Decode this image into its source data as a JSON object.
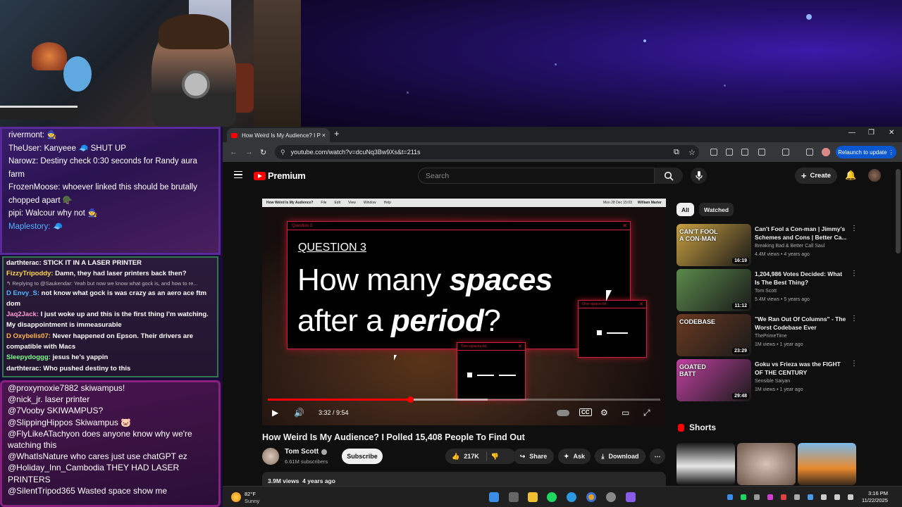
{
  "webcam": {
    "scene": "streamer-webcam"
  },
  "chat_top": [
    {
      "user": "rivermont:",
      "msg": " 🧙",
      "blue": false
    },
    {
      "user": "TheUser:",
      "msg": " Kanyeee 🧢 SHUT UP",
      "blue": false
    },
    {
      "user": "Narowz:",
      "msg": " Destiny check 0:30 seconds for Randy aura farm",
      "blue": false
    },
    {
      "user": "FrozenMoose:",
      "msg": " whoever linked this should be brutally chopped apart 🪖",
      "blue": false
    },
    {
      "user": "pipi:",
      "msg": " Walcour why not 🧙",
      "blue": false
    },
    {
      "user": "Maplestory:",
      "msg": " 🧢",
      "blue": true
    }
  ],
  "chat_mid": [
    {
      "user": "darthterac:",
      "msg": " STICK IT IN A LASER PRINTER",
      "color": "#ffffff"
    },
    {
      "user": "FizzyTripoddy:",
      "msg": " Damn, they had laser printers back then?",
      "color": "#ffd84a"
    },
    {
      "reply": "↰ Replying to @Saukendar: Yeah but now we know what gock is, and how to re..."
    },
    {
      "user": "D Envy_S:",
      "msg": " not know what gock is was crazy as an aero ace ftm dom",
      "color": "#4fb4ff"
    },
    {
      "user": "Jaq2Jack:",
      "msg": " I just woke up and this is the first thing I'm watching. My disappointment is immeasurable",
      "color": "#ff9ad0"
    },
    {
      "user": "D Oxybelis07:",
      "msg": " Never happened on Epson. Their drivers are compatible with Macs",
      "color": "#ffb84a"
    },
    {
      "user": "Sleepydoggg:",
      "msg": " jesus he's yappin",
      "color": "#7cff8a"
    },
    {
      "user": "darthterac:",
      "msg": " Who pushed destiny to this",
      "color": "#ffffff"
    }
  ],
  "chat_bot": [
    {
      "user": "@proxymoxie7882",
      "msg": " skiwampus!"
    },
    {
      "user": "@nick_jr.",
      "msg": " laser printer"
    },
    {
      "user": "@7Vooby",
      "msg": " SKIWAMPUS?"
    },
    {
      "user": "@SlippingHippos",
      "msg": " Skiwampus 🐷"
    },
    {
      "user": "@FlyLikeATachyon",
      "msg": " does anyone know why we're watching this"
    },
    {
      "user": "@WhatIsNature",
      "msg": " who cares just use chatGPT ez"
    },
    {
      "user": "@Holiday_Inn_Cambodia",
      "msg": " THEY HAD LASER PRINTERS"
    },
    {
      "user": "@SilentTripod365",
      "msg": " Wasted space show me"
    }
  ],
  "browser": {
    "tab_title": "How Weird Is My Audience? I P",
    "url": "youtube.com/watch?v=dcuNq3Bw9Xs&t=211s",
    "relaunch_label": "Relaunch to update"
  },
  "youtube": {
    "brand": "Premium",
    "search_placeholder": "Search",
    "create_label": "Create"
  },
  "player": {
    "mac_menu": [
      "How Weird Is My Audience?",
      "File",
      "Edit",
      "View",
      "Window",
      "Help"
    ],
    "mac_date": "Mon 28 Dec   15:03",
    "mac_user": "William Marter",
    "question_window_title": "Question 3",
    "question_label": "QUESTION 3",
    "question_line1_a": "How many ",
    "question_line1_b": "spaces",
    "question_line2_a": "after a ",
    "question_line2_b": "period",
    "question_line2_c": "?",
    "win_one_space_title": "One-space.txt",
    "win_two_spaces_title": "Two-spaces.txt",
    "time_label": "3:32 / 9:54",
    "progress": 0.362,
    "buffered": 0.56
  },
  "video": {
    "title": "How Weird Is My Audience? I Polled 15,408 People To Find Out",
    "channel": "Tom Scott",
    "subscribers": "6.61M subscribers",
    "subscribe_label": "Subscribe",
    "likes": "217K",
    "share_label": "Share",
    "ask_label": "Ask",
    "download_label": "Download",
    "views": "3.9M views",
    "age": "4 years ago"
  },
  "sidebar": {
    "chips": [
      "All",
      "Watched"
    ],
    "recommendations": [
      {
        "title": "Can't Fool a Con-man | Jimmy's Schemes and Cons | Better Ca...",
        "channel": "Breaking Bad & Better Call Saul",
        "meta": "4.4M views • 4 years ago",
        "duration": "16:19",
        "thumb_text": "CAN'T FOOL A CON-MAN",
        "thumb_color": "#c8a040"
      },
      {
        "title": "1,204,986 Votes Decided: What Is The Best Thing?",
        "channel": "Tom Scott",
        "meta": "5.4M views • 5 years ago",
        "duration": "11:12",
        "thumb_text": "",
        "thumb_color": "#5a8a4a"
      },
      {
        "title": "\"We Ran Out Of Columns\" - The Worst Codebase Ever",
        "channel": "ThePrimeTime",
        "meta": "1M views • 1 year ago",
        "duration": "23:29",
        "thumb_text": "CODEBASE",
        "thumb_color": "#6a3a20"
      },
      {
        "title": "Goku vs Frieza was the FIGHT OF THE CENTURY",
        "channel": "Sensible Saiyan",
        "meta": "1M views • 1 year ago",
        "duration": "29:48",
        "thumb_text": "GOATED BATT",
        "thumb_color": "#c040a0"
      }
    ],
    "shorts_label": "Shorts"
  },
  "taskbar": {
    "temp": "82°F",
    "condition": "Sunny",
    "time": "3:16 PM",
    "date": "11/22/2025"
  }
}
